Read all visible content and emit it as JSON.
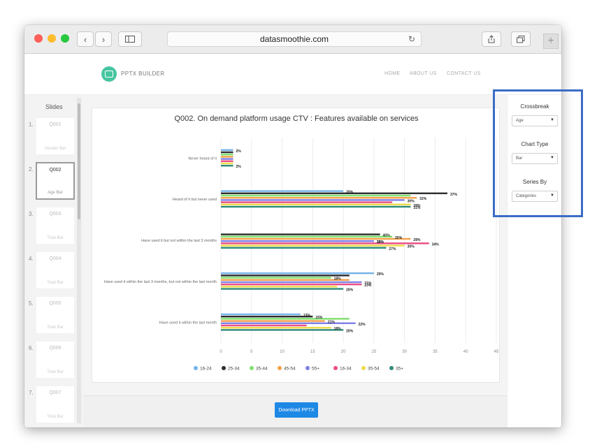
{
  "browser": {
    "url": "datasmoothie.com",
    "traffic_light_colors": [
      "#fe5f57",
      "#febc2e",
      "#28c840"
    ]
  },
  "site": {
    "brand": "PPTX BUILDER",
    "nav": [
      "HOME",
      "ABOUT US",
      "CONTACT US"
    ]
  },
  "slides": {
    "title": "Slides",
    "items": [
      {
        "num": "1.",
        "code": "Q001",
        "type": "Gender Bar"
      },
      {
        "num": "2.",
        "code": "Q002",
        "type": "Age Bar"
      },
      {
        "num": "3.",
        "code": "Q003",
        "type": "Total Bar"
      },
      {
        "num": "4.",
        "code": "Q004",
        "type": "Total Bar"
      },
      {
        "num": "5.",
        "code": "Q005",
        "type": "Total Bar"
      },
      {
        "num": "6.",
        "code": "Q006",
        "type": "Total Bar"
      },
      {
        "num": "7.",
        "code": "Q007",
        "type": "Total Bar"
      }
    ]
  },
  "download_label": "Download PPTX",
  "settings": {
    "crossbreak_label": "Crossbreak",
    "crossbreak_value": "Age",
    "charttype_label": "Chart Type",
    "charttype_value": "Bar",
    "seriesby_label": "Series By",
    "seriesby_value": "Categories"
  },
  "chart_data": {
    "type": "bar",
    "orientation": "horizontal",
    "title": "Q002. On demand platform usage CTV : Features available on services",
    "categories": [
      "Never heard of it",
      "Heard of it but never used",
      "Have used it but not within the last 3 months",
      "Have used it within the last 3 months, but not within the last month",
      "Have used it within the last month"
    ],
    "series": [
      {
        "name": "16-24",
        "color": "#74b3ea",
        "values": [
          2,
          20,
          null,
          25,
          13
        ]
      },
      {
        "name": "25-34",
        "color": "#2d2d2d",
        "values": [
          2,
          37,
          26,
          21,
          15
        ]
      },
      {
        "name": "35-44",
        "color": "#7fe06e",
        "values": [
          2,
          31,
          28,
          18,
          21
        ]
      },
      {
        "name": "45-54",
        "color": "#f3a14a",
        "values": [
          2,
          32,
          31,
          21,
          17
        ]
      },
      {
        "name": "55+",
        "color": "#7f7fe6",
        "values": [
          2,
          30,
          25,
          23,
          22
        ]
      },
      {
        "name": "16-34",
        "color": "#ea4c84",
        "values": [
          2,
          28,
          34,
          23,
          14
        ]
      },
      {
        "name": "35-54",
        "color": "#eddc4d",
        "values": [
          2,
          31,
          30,
          19,
          18
        ]
      },
      {
        "name": "35+",
        "color": "#2e8b7a",
        "values": [
          2,
          31,
          27,
          20,
          20
        ]
      }
    ],
    "value_labels": [
      [
        "2%",
        "2%"
      ],
      [
        "20%",
        "37%",
        "32%",
        "30%",
        "28%",
        "31%"
      ],
      [
        "40%",
        "26%",
        "28%",
        "31%",
        "25%",
        "34%",
        "30%",
        "27%"
      ],
      [
        "25%",
        "18%",
        "21%",
        "23%",
        "20%"
      ],
      [
        "13%",
        "15%",
        "21%",
        "22%",
        "18%",
        "20%"
      ]
    ],
    "xlim": [
      0,
      45
    ],
    "xticks": [
      0,
      5,
      10,
      15,
      20,
      25,
      30,
      35,
      40,
      45
    ],
    "grid": true,
    "legend_position": "bottom"
  }
}
